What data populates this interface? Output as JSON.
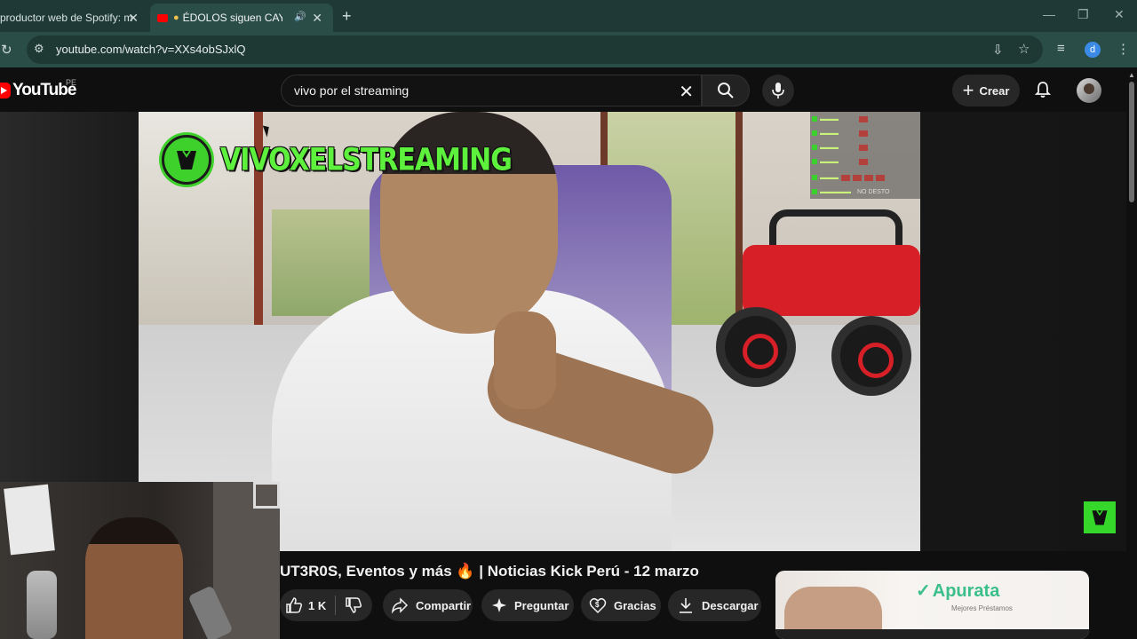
{
  "browser": {
    "tabs": [
      {
        "title": "productor web de Spotify: m",
        "active": false
      },
      {
        "title": "ÉDOLOS siguen CAYENDO",
        "active": true
      }
    ],
    "url": "youtube.com/watch?v=XXs4obSJxlQ"
  },
  "header": {
    "logo": "YouTube",
    "country": "PE",
    "search_query": "vivo por el streaming",
    "create_label": "Crear"
  },
  "video": {
    "overlay_brand": "VIVOXELSTREAMING",
    "title": "UT3R0S, Eventos y más 🔥 | Noticias Kick Perú - 12 marzo",
    "chat_tag": "NO DESTO"
  },
  "actions": {
    "likes": "1 K",
    "share": "Compartir",
    "ask": "Preguntar",
    "thanks": "Gracias",
    "download": "Descargar"
  },
  "ad": {
    "brand": "Apurata",
    "tagline": "Mejores Préstamos"
  },
  "colors": {
    "accent_green": "#3fd12b",
    "yt_red": "#ff0000",
    "chrome_tab": "#1f3a36"
  }
}
